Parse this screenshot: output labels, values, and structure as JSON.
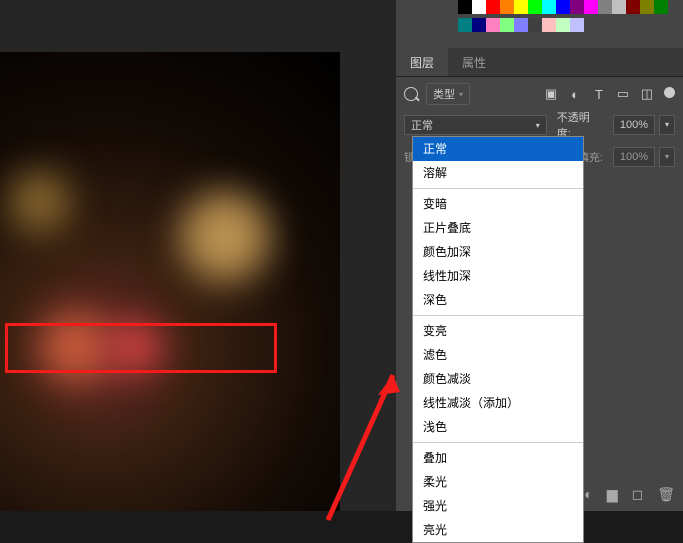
{
  "tabs": {
    "layers": "图层",
    "properties": "属性"
  },
  "filter": {
    "type_label": "类型"
  },
  "blend": {
    "current": "正常",
    "opacity_label": "不透明度:",
    "opacity_value": "100%",
    "fill_label": "填充:",
    "fill_value": "100%",
    "lock_label": "锁定:"
  },
  "blend_modes": {
    "g1": [
      "正常",
      "溶解"
    ],
    "g2": [
      "变暗",
      "正片叠底",
      "颜色加深",
      "线性加深",
      "深色"
    ],
    "g3": [
      "变亮",
      "滤色",
      "颜色减淡",
      "线性减淡（添加）",
      "浅色"
    ],
    "g4": [
      "叠加",
      "柔光",
      "强光",
      "亮光"
    ]
  },
  "swatch_colors": [
    "#000",
    "#fff",
    "#f00",
    "#ff8000",
    "#ff0",
    "#0f0",
    "#0ff",
    "#00f",
    "#800080",
    "#f0f",
    "#808080",
    "#c0c0c0",
    "#800000",
    "#808000",
    "#008000",
    "#008080",
    "#000080",
    "#ff80c0",
    "#80ff80",
    "#8080ff",
    "#404040",
    "#ffc0c0",
    "#c0ffc0",
    "#c0c0ff"
  ]
}
